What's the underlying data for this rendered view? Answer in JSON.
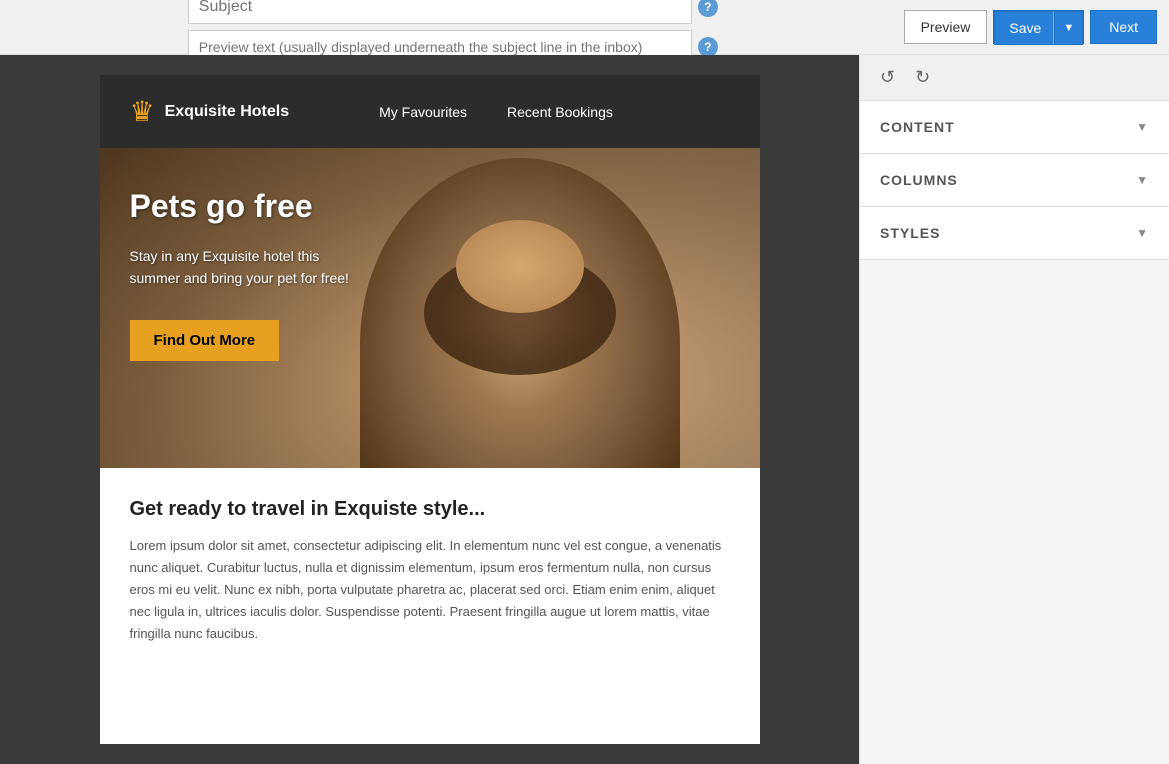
{
  "topbar": {
    "subject_placeholder": "Subject",
    "preview_placeholder": "Preview text (usually displayed underneath the subject line in the inbox)",
    "preview_btn": "Preview",
    "save_btn": "Save",
    "next_btn": "Next"
  },
  "email": {
    "logo_name": "Exquisite\nHotels",
    "nav_items": [
      "My Favourites",
      "Recent Bookings"
    ],
    "hero_title": "Pets go free",
    "hero_body": "Stay in any Exquisite hotel this summer and bring your pet for free!",
    "hero_cta": "Find Out More",
    "body_heading": "Get ready to travel in Exquiste style...",
    "body_text": "Lorem ipsum dolor sit amet, consectetur adipiscing elit. In elementum nunc vel est congue, a venenatis nunc aliquet. Curabitur luctus, nulla et dignissim elementum, ipsum eros fermentum nulla, non cursus eros mi eu velit. Nunc ex nibh, porta vulputate pharetra ac, placerat sed orci. Etiam enim enim, aliquet nec ligula in, ultrices iaculis dolor. Suspendisse potenti. Praesent fringilla augue ut lorem mattis, vitae fringilla nunc faucibus."
  },
  "panel": {
    "undo_label": "↺",
    "redo_label": "↻",
    "sections": [
      {
        "id": "content",
        "label": "CONTENT"
      },
      {
        "id": "columns",
        "label": "COLUMNS"
      },
      {
        "id": "styles",
        "label": "STYLES"
      }
    ]
  }
}
